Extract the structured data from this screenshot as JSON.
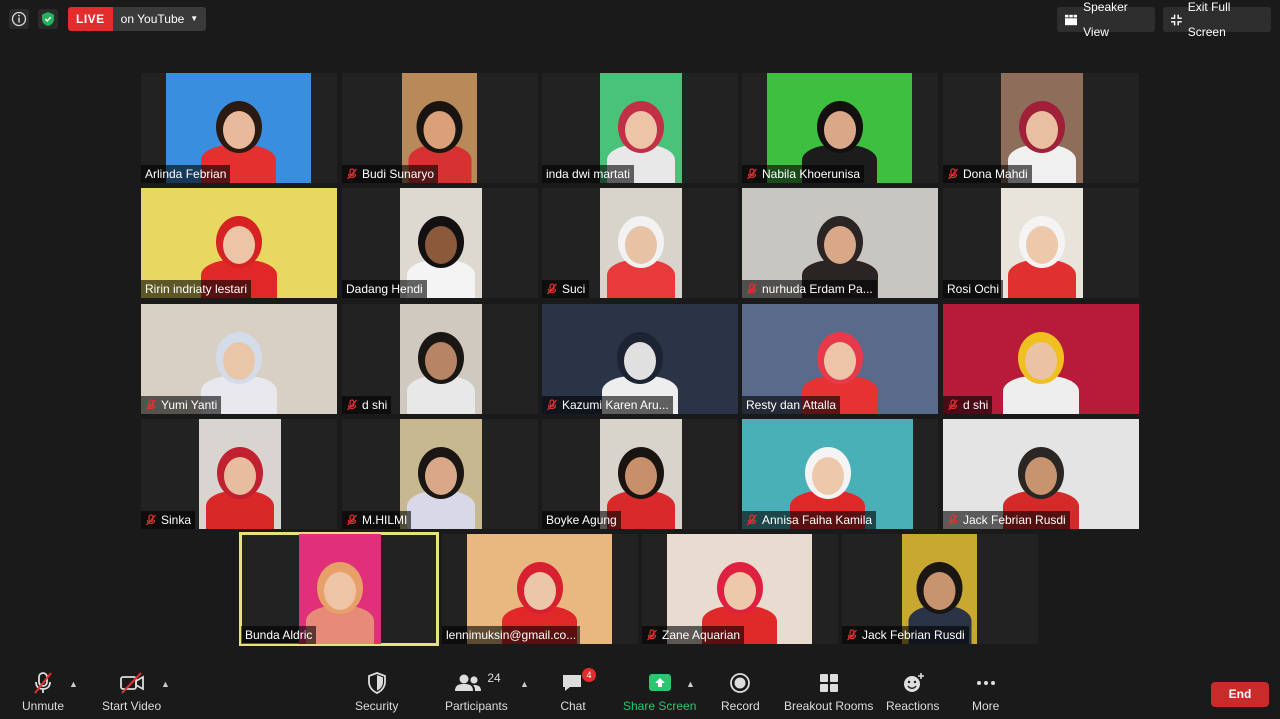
{
  "topbar": {
    "live_label": "LIVE",
    "live_destination": "on YouTube",
    "speaker_view": "Speaker View",
    "exit_full_screen": "Exit Full Screen"
  },
  "participants": [
    {
      "name": "Arlinda Febrian",
      "muted": false,
      "bg": "#3a8ee0",
      "shirt": "#e53030",
      "hair": "#2a1a12",
      "skin": "#e8b99a"
    },
    {
      "name": "Budi Sunaryo",
      "muted": true,
      "bg": "#b88a5a",
      "shirt": "#d63232",
      "hair": "#1a1410",
      "skin": "#d9a07a"
    },
    {
      "name": "inda dwi martati",
      "muted": false,
      "bg": "#49c27a",
      "shirt": "#e8e8e8",
      "hair": "#c23048",
      "skin": "#edc4a8"
    },
    {
      "name": "Nabila Khoerunisa",
      "muted": true,
      "bg": "#3fbf3f",
      "shirt": "#1c1c1c",
      "hair": "#141010",
      "skin": "#d9a888"
    },
    {
      "name": "Dona Mahdi",
      "muted": true,
      "bg": "#8e6e5a",
      "shirt": "#f0f0f0",
      "hair": "#a0203a",
      "skin": "#e8c0a0"
    },
    {
      "name": "Ririn indriaty lestari",
      "muted": false,
      "bg": "#e8d860",
      "shirt": "#e02828",
      "hair": "#d62222",
      "skin": "#ecc4a6"
    },
    {
      "name": "Dadang Hendi",
      "muted": false,
      "bg": "#ddd8d0",
      "shirt": "#f4f4f4",
      "hair": "#121010",
      "skin": "#8a5a3a"
    },
    {
      "name": "Suci",
      "muted": true,
      "bg": "#d8d4cc",
      "shirt": "#e83a3a",
      "hair": "#f2f2f2",
      "skin": "#e8c2a4"
    },
    {
      "name": "nurhuda Erdam Pa...",
      "muted": true,
      "bg": "#c8c6c0",
      "shirt": "#2a2424",
      "hair": "#2a2424",
      "skin": "#d8a888"
    },
    {
      "name": "Rosi Ochi",
      "muted": false,
      "bg": "#e8e4dc",
      "shirt": "#e03030",
      "hair": "#f4f4f4",
      "skin": "#eec8aa"
    },
    {
      "name": "Yumi Yanti",
      "muted": true,
      "bg": "#d8d0c4",
      "shirt": "#e8e8ee",
      "hair": "#d4dcea",
      "skin": "#eac6a8"
    },
    {
      "name": "d shi",
      "muted": true,
      "bg": "#cfc9bf",
      "shirt": "#e8e8e8",
      "hair": "#1a1614",
      "skin": "#b88466"
    },
    {
      "name": "Kazumi Karen Aru...",
      "muted": true,
      "bg": "#2a3446",
      "shirt": "#eeeeee",
      "hair": "#1c2433",
      "skin": "#e0e0e0"
    },
    {
      "name": "Resty dan Attalla",
      "muted": false,
      "bg": "#5a6a8a",
      "shirt": "#e63232",
      "hair": "#e63a4a",
      "skin": "#ecc4a8"
    },
    {
      "name": "d shi",
      "muted": true,
      "bg": "#b81a3a",
      "shirt": "#eeeeee",
      "hair": "#f0c020",
      "skin": "#eac2a4"
    },
    {
      "name": "Sinka",
      "muted": true,
      "bg": "#d8d4d0",
      "shirt": "#d82828",
      "hair": "#c02030",
      "skin": "#e8bc9e"
    },
    {
      "name": "M.HILMI",
      "muted": true,
      "bg": "#c8b890",
      "shirt": "#d8d8e8",
      "hair": "#1a1614",
      "skin": "#d8a888"
    },
    {
      "name": "Boyke Agung",
      "muted": false,
      "bg": "#d8d4cc",
      "shirt": "#d82a2a",
      "hair": "#1a1410",
      "skin": "#c8906a"
    },
    {
      "name": "Annisa Faiha Kamila",
      "muted": true,
      "bg": "#4ab0b8",
      "shirt": "#e02828",
      "hair": "#f4f4f4",
      "skin": "#eec8aa"
    },
    {
      "name": "Jack Febrian Rusdi",
      "muted": true,
      "bg": "#e4e4e4",
      "shirt": "#d42a2a",
      "hair": "#2a2624",
      "skin": "#c8946e"
    },
    {
      "name": "Bunda Aldric",
      "muted": false,
      "bg": "#e0307a",
      "shirt": "#e88a7a",
      "hair": "#e8a06a",
      "skin": "#eec4a6"
    },
    {
      "name": "lennimuksin@gmail.co...",
      "muted": false,
      "bg": "#e8b880",
      "shirt": "#e02828",
      "hair": "#d82030",
      "skin": "#ecc6a8"
    },
    {
      "name": "Zane Aquarian",
      "muted": true,
      "bg": "#e8dcd0",
      "shirt": "#e02a2a",
      "hair": "#e02040",
      "skin": "#eec8aa"
    },
    {
      "name": "Jack Febrian Rusdi",
      "muted": true,
      "bg": "#c8a830",
      "shirt": "#2a3446",
      "hair": "#1a1614",
      "skin": "#c8946e"
    }
  ],
  "toolbar": {
    "unmute": "Unmute",
    "start_video": "Start Video",
    "security": "Security",
    "participants": "Participants",
    "participants_count": "24",
    "chat": "Chat",
    "chat_badge": "4",
    "share_screen": "Share Screen",
    "record": "Record",
    "breakout_rooms": "Breakout Rooms",
    "reactions": "Reactions",
    "more": "More",
    "end": "End",
    "share_color": "#28c76f",
    "end_color": "#c92a2a"
  }
}
